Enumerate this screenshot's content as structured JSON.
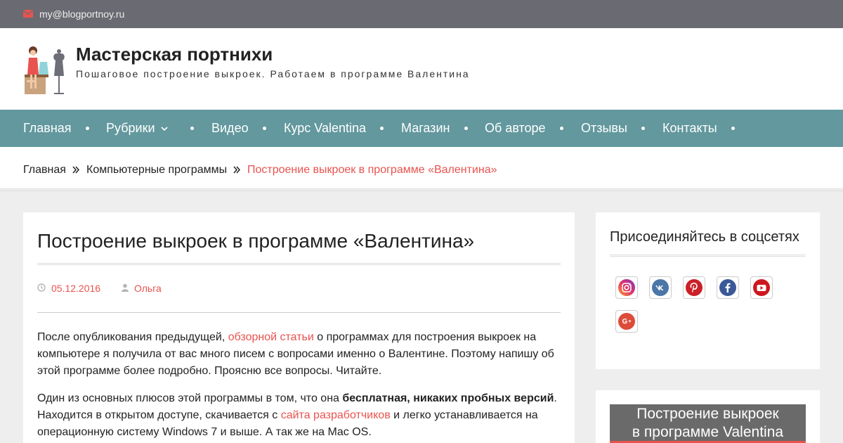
{
  "topbar": {
    "email": "my@blogportnoy.ru",
    "icon": "envelope-icon"
  },
  "header": {
    "title": "Мастерская портнихи",
    "tagline": "Пошаговое построение выкроек. Работаем в программе Валентина"
  },
  "nav": {
    "items": [
      {
        "label": "Главная"
      },
      {
        "label": "Рубрики"
      },
      {
        "label": "Видео"
      },
      {
        "label": "Курс Valentina"
      },
      {
        "label": "Магазин"
      },
      {
        "label": "Об авторе"
      },
      {
        "label": "Отзывы"
      },
      {
        "label": "Контакты"
      }
    ]
  },
  "breadcrumb": {
    "items": [
      "Главная",
      "Компьютерные программы"
    ],
    "current": "Построение выкроек в программе «Валентина»"
  },
  "article": {
    "title": "Построение выкроек в программе «Валентина»",
    "date": "05.12.2016",
    "author": "Ольга",
    "p1_before": "После опубликования предыдущей, ",
    "p1_link": "обзорной статьи",
    "p1_after": " о программах для построения выкроек на компьютере я получила от вас много писем с вопросами именно о Валентине. Поэтому напишу об этой программе более подробно. Проясню все вопросы. Читайте.",
    "p2_before": "Один из основных плюсов этой программы в том, что она ",
    "p2_bold": "бесплатная, никаких пробных версий",
    "p2_mid": ". Находится в открытом доступе, скачивается с ",
    "p2_link": "сайта разработчиков",
    "p2_after": " и легко устанавливается на операционную систему Windows 7 и выше. А так же на Mac OS."
  },
  "sidebar": {
    "social_title": "Присоединяйтесь в соцсетях",
    "social_icons": [
      "instagram-icon",
      "vk-icon",
      "pinterest-icon",
      "facebook-icon",
      "youtube-icon",
      "google-plus-icon"
    ],
    "promo_line1": "Построение выкроек",
    "promo_line2": "в программе Valentina"
  },
  "colors": {
    "accent": "#e8534f",
    "nav": "#62989e",
    "topbar": "#6a6a72"
  }
}
